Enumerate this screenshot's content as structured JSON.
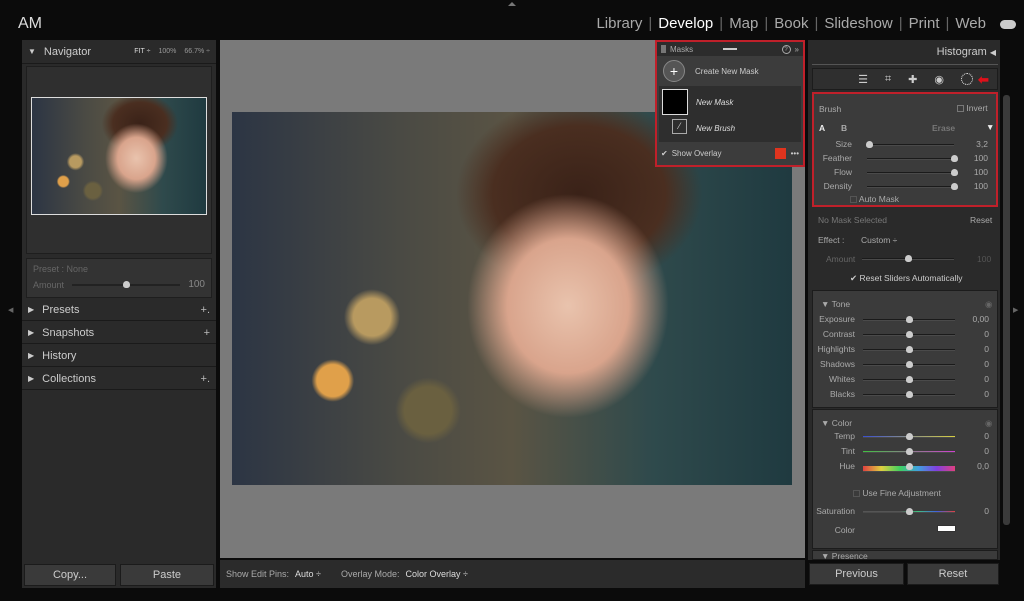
{
  "topbar": {
    "logo": "AM",
    "modules": [
      "Library",
      "Develop",
      "Map",
      "Book",
      "Slideshow",
      "Print",
      "Web"
    ],
    "active_module": "Develop",
    "cloud_icon": "cloud-icon"
  },
  "left": {
    "navigator": {
      "title": "Navigator",
      "fit": "FIT ÷",
      "z100": "100%",
      "z667": "66.7% ÷"
    },
    "preset": {
      "label": "Preset : None",
      "amount_label": "Amount",
      "amount_value": "100",
      "amount_fraction": 0.5
    },
    "panels": [
      {
        "label": "Presets",
        "plus": "+."
      },
      {
        "label": "Snapshots",
        "plus": "+"
      },
      {
        "label": "History",
        "plus": ""
      },
      {
        "label": "Collections",
        "plus": "+."
      }
    ],
    "copy": "Copy...",
    "paste": "Paste"
  },
  "toolbar": {
    "pins_label": "Show Edit Pins:",
    "pins_value": "Auto ÷",
    "overlay_label": "Overlay Mode:",
    "overlay_value": "Color Overlay ÷"
  },
  "masks": {
    "title": "Masks",
    "create": "Create New Mask",
    "mask_name": "New Mask",
    "brush_name": "New Brush",
    "show_overlay": "Show Overlay",
    "show_overlay_checked": true,
    "overlay_color": "#e0341e",
    "more": "•••",
    "help": "?",
    "collapse": "»"
  },
  "right": {
    "histogram": "Histogram",
    "brush": {
      "title": "Brush",
      "invert": "Invert",
      "a": "A",
      "b": "B",
      "erase": "Erase",
      "sliders": [
        {
          "label": "Size",
          "value": "3,2",
          "pos": 0.02
        },
        {
          "label": "Feather",
          "value": "100",
          "pos": 1
        },
        {
          "label": "Flow",
          "value": "100",
          "pos": 1
        },
        {
          "label": "Density",
          "value": "100",
          "pos": 1
        }
      ],
      "auto_mask": "Auto Mask"
    },
    "mask_status": "No Mask Selected",
    "reset": "Reset",
    "effect_label": "Effect :",
    "effect_value": "Custom ÷",
    "amount_label": "Amount",
    "amount_value": "100",
    "reset_sliders": "Reset Sliders Automatically",
    "tone": {
      "title": "Tone",
      "sliders": [
        {
          "label": "Exposure",
          "value": "0,00",
          "pos": 0.5
        },
        {
          "label": "Contrast",
          "value": "0",
          "pos": 0.5
        },
        {
          "label": "Highlights",
          "value": "0",
          "pos": 0.5
        },
        {
          "label": "Shadows",
          "value": "0",
          "pos": 0.5
        },
        {
          "label": "Whites",
          "value": "0",
          "pos": 0.5
        },
        {
          "label": "Blacks",
          "value": "0",
          "pos": 0.5
        }
      ]
    },
    "color": {
      "title": "Color",
      "sliders": [
        {
          "label": "Temp",
          "value": "0",
          "pos": 0.5,
          "grad": "linear-gradient(90deg,#3a4fd0,#d8d040)"
        },
        {
          "label": "Tint",
          "value": "0",
          "pos": 0.5,
          "grad": "linear-gradient(90deg,#40c040,#d040d0)"
        },
        {
          "label": "Hue",
          "value": "0,0",
          "pos": 0.5,
          "grad": "linear-gradient(90deg,#e04040,#e0d040,#40d060,#40a0e0,#8040e0,#e04080)"
        }
      ],
      "fine": "Use Fine Adjustment",
      "saturation": {
        "label": "Saturation",
        "value": "0",
        "pos": 0.5
      },
      "color_label": "Color"
    },
    "presence": "Presence",
    "previous": "Previous",
    "reset_btn": "Reset"
  },
  "accent_red": "#c0202a"
}
